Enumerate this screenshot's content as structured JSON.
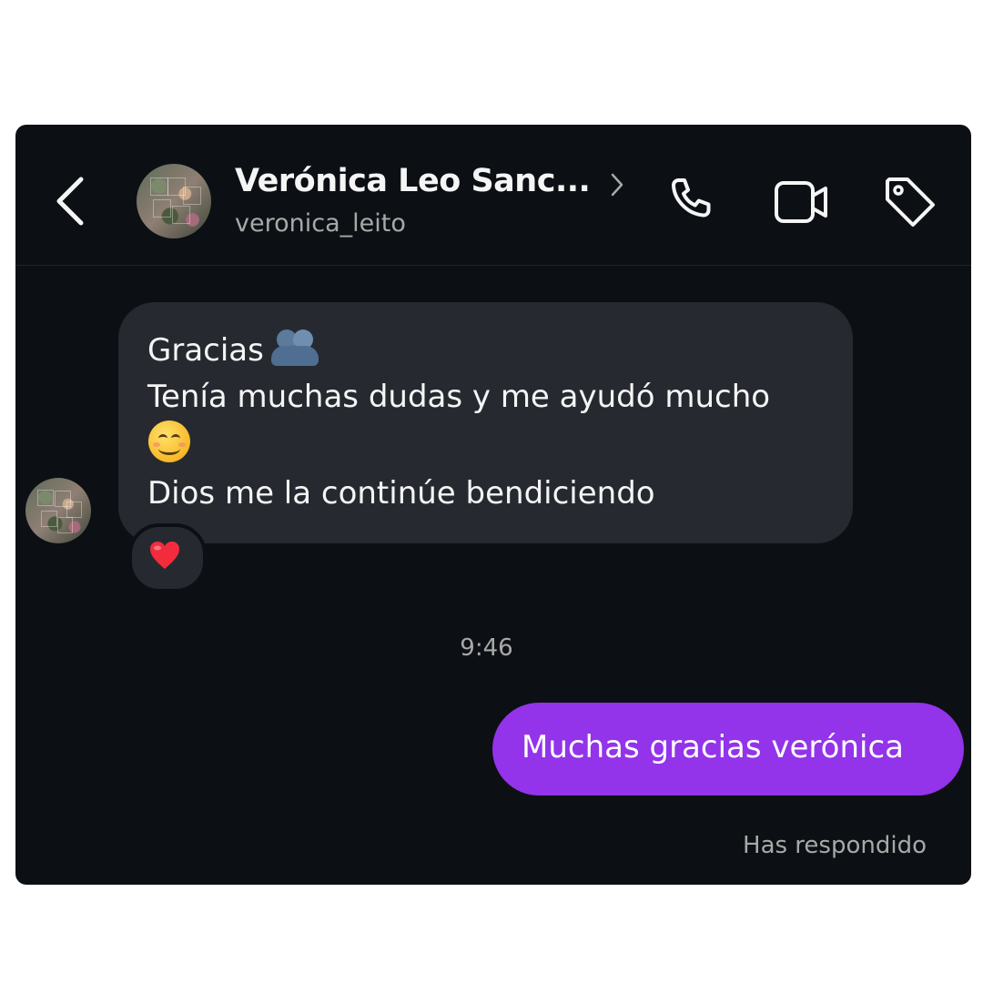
{
  "header": {
    "contact_name": "Verónica Leo Sanc...",
    "username": "veronica_leito"
  },
  "icons": {
    "back": "chevron-left-icon",
    "call": "phone-icon",
    "video": "video-camera-icon",
    "tag": "tag-icon",
    "reaction": "red-heart-emoji"
  },
  "messages": {
    "incoming": {
      "line1": "Gracias",
      "line2": "Tenía muchas dudas y me ayudó mucho",
      "line3": "Dios me la continúe bendiciendo",
      "emoji1": "people-hugging-emoji",
      "emoji2": "smiling-face-with-smiling-eyes-emoji",
      "reaction": "❤️"
    },
    "timestamp": "9:46",
    "outgoing": {
      "text": "Muchas gracias verónica"
    },
    "status": "Has respondido"
  },
  "colors": {
    "background": "#0c1014",
    "incoming_bubble": "#262a30",
    "outgoing_bubble": "#9333ea",
    "secondary_text": "#a8a8a8",
    "primary_text": "#f5f5f5"
  }
}
